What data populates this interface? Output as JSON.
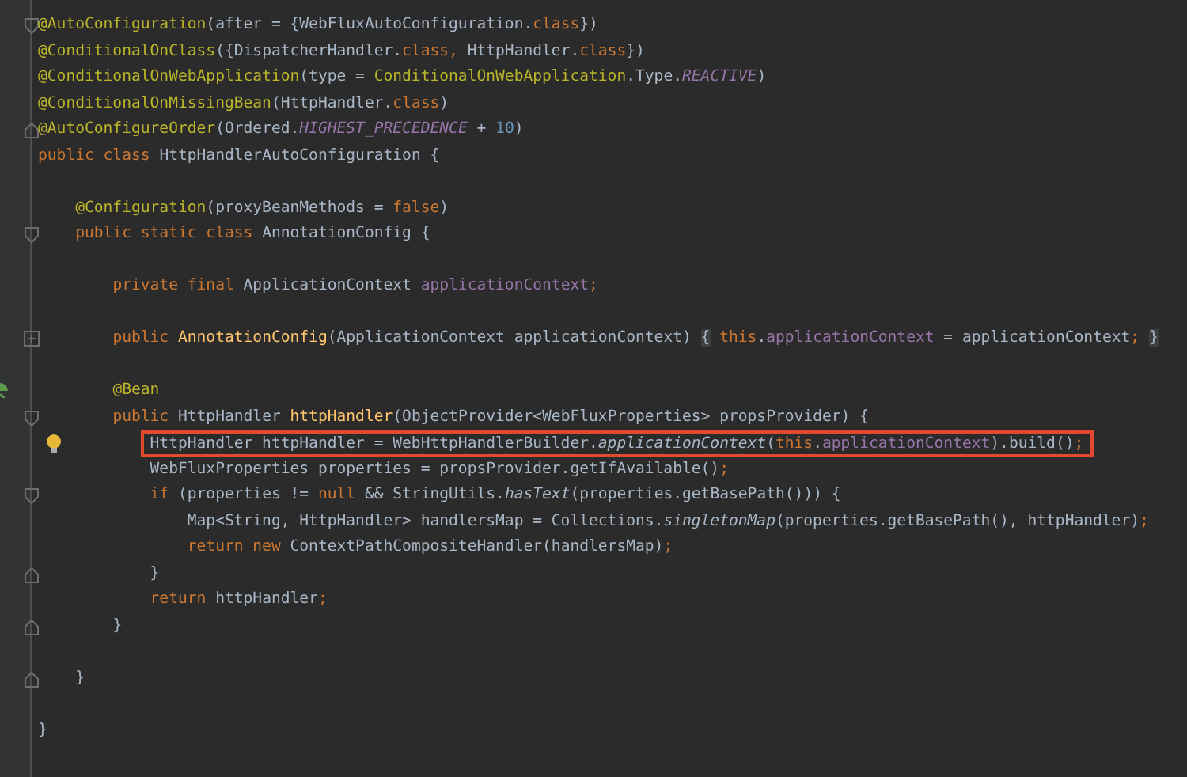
{
  "lines": [
    {
      "kind": "fold-start",
      "highlighted": false,
      "tokens": [
        {
          "kind": "annotation",
          "text": "@AutoConfiguration"
        },
        {
          "kind": "plain",
          "text": "(after = {WebFluxAutoConfiguration."
        },
        {
          "kind": "keyword",
          "text": "class"
        },
        {
          "kind": "plain",
          "text": "})"
        }
      ]
    },
    {
      "highlighted": false,
      "tokens": [
        {
          "kind": "annotation",
          "text": "@ConditionalOnClass"
        },
        {
          "kind": "plain",
          "text": "({DispatcherHandler."
        },
        {
          "kind": "keyword",
          "text": "class, "
        },
        {
          "kind": "plain",
          "text": "HttpHandler."
        },
        {
          "kind": "keyword",
          "text": "class"
        },
        {
          "kind": "plain",
          "text": "})"
        }
      ]
    },
    {
      "highlighted": false,
      "tokens": [
        {
          "kind": "annotation",
          "text": "@ConditionalOnWebApplication"
        },
        {
          "kind": "plain",
          "text": "(type = "
        },
        {
          "kind": "annotation",
          "text": "ConditionalOnWebApplication"
        },
        {
          "kind": "plain",
          "text": ".Type."
        },
        {
          "kind": "constant",
          "text": "REACTIVE"
        },
        {
          "kind": "plain",
          "text": ")"
        }
      ]
    },
    {
      "highlighted": false,
      "tokens": [
        {
          "kind": "annotation",
          "text": "@ConditionalOnMissingBean"
        },
        {
          "kind": "plain",
          "text": "(HttpHandler."
        },
        {
          "kind": "keyword",
          "text": "class"
        },
        {
          "kind": "plain",
          "text": ")"
        }
      ]
    },
    {
      "kind": "fold-end",
      "highlighted": false,
      "tokens": [
        {
          "kind": "annotation",
          "text": "@AutoConfigureOrder"
        },
        {
          "kind": "plain",
          "text": "(Ordered."
        },
        {
          "kind": "constant",
          "text": "HIGHEST_PRECEDENCE"
        },
        {
          "kind": "plain",
          "text": " + "
        },
        {
          "kind": "number",
          "text": "10"
        },
        {
          "kind": "plain",
          "text": ")"
        }
      ]
    },
    {
      "highlighted": false,
      "tokens": [
        {
          "kind": "keyword",
          "text": "public class "
        },
        {
          "kind": "plain",
          "text": "HttpHandlerAutoConfiguration {"
        }
      ]
    },
    {
      "highlighted": false
    },
    {
      "highlighted": false,
      "tokens": [
        {
          "kind": "annotation",
          "text": "    @Configuration"
        },
        {
          "kind": "plain",
          "text": "(proxyBeanMethods = "
        },
        {
          "kind": "keyword",
          "text": "false"
        },
        {
          "kind": "plain",
          "text": ")"
        }
      ]
    },
    {
      "kind": "fold-start",
      "highlighted": false,
      "tokens": [
        {
          "kind": "keyword",
          "text": "    public static class "
        },
        {
          "kind": "plain",
          "text": "AnnotationConfig {"
        }
      ]
    },
    {
      "highlighted": false
    },
    {
      "highlighted": false,
      "tokens": [
        {
          "kind": "keyword",
          "text": "        private final "
        },
        {
          "kind": "plain",
          "text": "ApplicationContext "
        },
        {
          "kind": "field",
          "text": "applicationContext"
        },
        {
          "kind": "keyword",
          "text": ";"
        }
      ]
    },
    {
      "highlighted": false
    },
    {
      "kind": "expand",
      "highlighted": false,
      "tokens": [
        {
          "kind": "keyword",
          "text": "        public "
        },
        {
          "kind": "method",
          "text": "AnnotationConfig"
        },
        {
          "kind": "plain",
          "text": "(ApplicationContext applicationContext) "
        },
        {
          "kind": "folded",
          "text": "{"
        },
        {
          "kind": "keyword",
          "text": " this"
        },
        {
          "kind": "plain",
          "text": "."
        },
        {
          "kind": "field",
          "text": "applicationContext"
        },
        {
          "kind": "plain",
          "text": " = applicationContext"
        },
        {
          "kind": "keyword",
          "text": "; "
        },
        {
          "kind": "folded",
          "text": "}"
        }
      ]
    },
    {
      "highlighted": false
    },
    {
      "kind": "bean",
      "highlighted": false,
      "tokens": [
        {
          "kind": "annotation",
          "text": "        @Bean"
        }
      ]
    },
    {
      "kind": "fold-start",
      "highlighted": false,
      "tokens": [
        {
          "kind": "keyword",
          "text": "        public "
        },
        {
          "kind": "plain",
          "text": "HttpHandler "
        },
        {
          "kind": "method",
          "text": "httpHandler"
        },
        {
          "kind": "plain",
          "text": "(ObjectProvider<WebFluxProperties> propsProvider) {"
        }
      ]
    },
    {
      "kind": "bulb",
      "highlighted": true,
      "tokens": [
        {
          "kind": "plain",
          "text": "            HttpHandler httpHandler = WebHttpHandlerBuilder."
        },
        {
          "kind": "call",
          "text": "applicationContext"
        },
        {
          "kind": "plain",
          "text": "("
        },
        {
          "kind": "keyword",
          "text": "this"
        },
        {
          "kind": "plain",
          "text": "."
        },
        {
          "kind": "field",
          "text": "applicationContext"
        },
        {
          "kind": "plain",
          "text": ").build()"
        },
        {
          "kind": "keyword",
          "text": ";"
        }
      ]
    },
    {
      "highlighted": false,
      "tokens": [
        {
          "kind": "plain",
          "text": "            WebFluxProperties properties = propsProvider.getIfAvailable()"
        },
        {
          "kind": "keyword",
          "text": ";"
        }
      ]
    },
    {
      "kind": "fold-start",
      "highlighted": false,
      "tokens": [
        {
          "kind": "keyword",
          "text": "            if "
        },
        {
          "kind": "plain",
          "text": "(properties != "
        },
        {
          "kind": "keyword",
          "text": "null"
        },
        {
          "kind": "plain",
          "text": " && StringUtils."
        },
        {
          "kind": "call",
          "text": "hasText"
        },
        {
          "kind": "plain",
          "text": "(properties.getBasePath())) {"
        }
      ]
    },
    {
      "highlighted": false,
      "tokens": [
        {
          "kind": "plain",
          "text": "                Map<String, HttpHandler> handlersMap = Collections."
        },
        {
          "kind": "call",
          "text": "singletonMap"
        },
        {
          "kind": "plain",
          "text": "(properties.getBasePath(), httpHandler)"
        },
        {
          "kind": "keyword",
          "text": ";"
        }
      ]
    },
    {
      "highlighted": false,
      "tokens": [
        {
          "kind": "keyword",
          "text": "                return new "
        },
        {
          "kind": "plain",
          "text": "ContextPathCompositeHandler(handlersMap)"
        },
        {
          "kind": "keyword",
          "text": ";"
        }
      ]
    },
    {
      "kind": "fold-end",
      "highlighted": false,
      "tokens": [
        {
          "kind": "plain",
          "text": "            }"
        }
      ]
    },
    {
      "highlighted": false,
      "tokens": [
        {
          "kind": "keyword",
          "text": "            return "
        },
        {
          "kind": "plain",
          "text": "httpHandler"
        },
        {
          "kind": "keyword",
          "text": ";"
        }
      ]
    },
    {
      "kind": "fold-end",
      "highlighted": false,
      "tokens": [
        {
          "kind": "plain",
          "text": "        }"
        }
      ]
    },
    {
      "highlighted": false
    },
    {
      "kind": "fold-end",
      "highlighted": false,
      "tokens": [
        {
          "kind": "plain",
          "text": "    }"
        }
      ]
    },
    {
      "highlighted": false
    },
    {
      "highlighted": false,
      "tokens": [
        {
          "kind": "plain",
          "text": "}"
        }
      ]
    }
  ]
}
